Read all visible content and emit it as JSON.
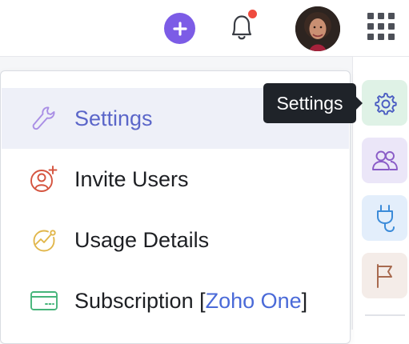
{
  "header": {
    "add_icon": "plus-icon",
    "notification_icon": "bell-icon",
    "has_unread_notifications": true,
    "apps_icon": "grid-icon",
    "avatar": "user-avatar"
  },
  "menu": {
    "items": [
      {
        "label": "Settings",
        "icon": "wrench-icon",
        "active": true
      },
      {
        "label": "Invite Users",
        "icon": "add-user-icon"
      },
      {
        "label": "Usage Details",
        "icon": "usage-chart-icon"
      },
      {
        "label_prefix": "Subscription [",
        "plan": "Zoho One",
        "label_suffix": "]",
        "icon": "credit-card-icon"
      }
    ]
  },
  "rail": {
    "items": [
      {
        "icon": "gear-icon",
        "color": "#dff2e6"
      },
      {
        "icon": "users-icon",
        "color": "#ebe6f8"
      },
      {
        "icon": "plug-icon",
        "color": "#e3eefb"
      },
      {
        "icon": "flag-icon",
        "color": "#f4ece8"
      }
    ]
  },
  "tooltip": {
    "text": "Settings"
  },
  "colors": {
    "accent": "#7c5ce6",
    "active_text": "#5b66c9",
    "plan_text": "#4a6ad8",
    "notification_dot": "#ef4b3f"
  }
}
